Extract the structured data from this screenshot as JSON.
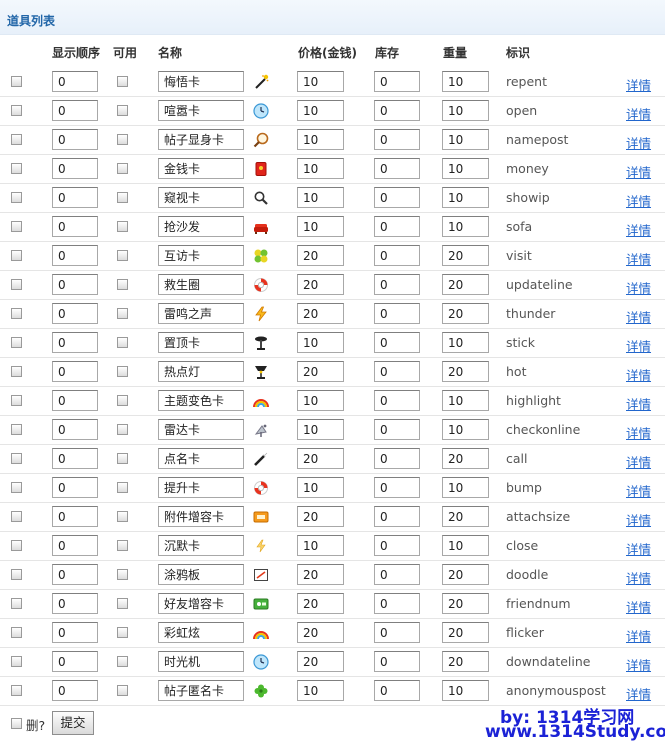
{
  "section_title": "道具列表",
  "headers": {
    "order": "显示顺序",
    "enabled": "可用",
    "name": "名称",
    "price": "价格(金钱)",
    "stock": "库存",
    "weight": "重量",
    "ident": "标识"
  },
  "items": [
    {
      "order": "0",
      "name": "悔悟卡",
      "icon": "magic-wand-icon",
      "price": "10",
      "stock": "0",
      "weight": "10",
      "ident": "repent",
      "detail": "详情"
    },
    {
      "order": "0",
      "name": "喧嚣卡",
      "icon": "clock-icon",
      "price": "10",
      "stock": "0",
      "weight": "10",
      "ident": "open",
      "detail": "详情"
    },
    {
      "order": "0",
      "name": "帖子显身卡",
      "icon": "magnifier-icon",
      "price": "10",
      "stock": "0",
      "weight": "10",
      "ident": "namepost",
      "detail": "详情"
    },
    {
      "order": "0",
      "name": "金钱卡",
      "icon": "red-envelope-icon",
      "price": "10",
      "stock": "0",
      "weight": "10",
      "ident": "money",
      "detail": "详情"
    },
    {
      "order": "0",
      "name": "窥视卡",
      "icon": "magnifier-small-icon",
      "price": "10",
      "stock": "0",
      "weight": "10",
      "ident": "showip",
      "detail": "详情"
    },
    {
      "order": "0",
      "name": "抢沙发",
      "icon": "sofa-icon",
      "price": "10",
      "stock": "0",
      "weight": "10",
      "ident": "sofa",
      "detail": "详情"
    },
    {
      "order": "0",
      "name": "互访卡",
      "icon": "visit-icon",
      "price": "20",
      "stock": "0",
      "weight": "20",
      "ident": "visit",
      "detail": "详情"
    },
    {
      "order": "0",
      "name": "救生圈",
      "icon": "life-ring-icon",
      "price": "20",
      "stock": "0",
      "weight": "20",
      "ident": "updateline",
      "detail": "详情"
    },
    {
      "order": "0",
      "name": "雷鸣之声",
      "icon": "lightning-icon",
      "price": "20",
      "stock": "0",
      "weight": "20",
      "ident": "thunder",
      "detail": "详情"
    },
    {
      "order": "0",
      "name": "置顶卡",
      "icon": "pin-icon",
      "price": "10",
      "stock": "0",
      "weight": "10",
      "ident": "stick",
      "detail": "详情"
    },
    {
      "order": "0",
      "name": "热点灯",
      "icon": "lamp-icon",
      "price": "20",
      "stock": "0",
      "weight": "20",
      "ident": "hot",
      "detail": "详情"
    },
    {
      "order": "0",
      "name": "主题变色卡",
      "icon": "rainbow-icon",
      "price": "10",
      "stock": "0",
      "weight": "10",
      "ident": "highlight",
      "detail": "详情"
    },
    {
      "order": "0",
      "name": "雷达卡",
      "icon": "radar-icon",
      "price": "10",
      "stock": "0",
      "weight": "10",
      "ident": "checkonline",
      "detail": "详情"
    },
    {
      "order": "0",
      "name": "点名卡",
      "icon": "wand-icon",
      "price": "20",
      "stock": "0",
      "weight": "20",
      "ident": "call",
      "detail": "详情"
    },
    {
      "order": "0",
      "name": "提升卡",
      "icon": "life-ring-icon",
      "price": "10",
      "stock": "0",
      "weight": "10",
      "ident": "bump",
      "detail": "详情"
    },
    {
      "order": "0",
      "name": "附件增容卡",
      "icon": "attachment-card-icon",
      "price": "20",
      "stock": "0",
      "weight": "20",
      "ident": "attachsize",
      "detail": "详情"
    },
    {
      "order": "0",
      "name": "沉默卡",
      "icon": "lightning-small-icon",
      "price": "10",
      "stock": "0",
      "weight": "10",
      "ident": "close",
      "detail": "详情"
    },
    {
      "order": "0",
      "name": "涂鸦板",
      "icon": "doodle-board-icon",
      "price": "20",
      "stock": "0",
      "weight": "20",
      "ident": "doodle",
      "detail": "详情"
    },
    {
      "order": "0",
      "name": "好友增容卡",
      "icon": "friend-card-icon",
      "price": "20",
      "stock": "0",
      "weight": "20",
      "ident": "friendnum",
      "detail": "详情"
    },
    {
      "order": "0",
      "name": "彩虹炫",
      "icon": "rainbow-icon",
      "price": "20",
      "stock": "0",
      "weight": "20",
      "ident": "flicker",
      "detail": "详情"
    },
    {
      "order": "0",
      "name": "时光机",
      "icon": "clock-icon",
      "price": "20",
      "stock": "0",
      "weight": "20",
      "ident": "downdateline",
      "detail": "详情"
    },
    {
      "order": "0",
      "name": "帖子匿名卡",
      "icon": "clover-icon",
      "price": "10",
      "stock": "0",
      "weight": "10",
      "ident": "anonymouspost",
      "detail": "详情"
    }
  ],
  "footer": {
    "delete_label": "删?",
    "submit_label": "提交"
  },
  "watermark": {
    "line1": "by: 1314学习网",
    "line2": "www.1314Study.com"
  },
  "colors": {
    "title": "#2266a8",
    "link": "#2266cc",
    "watermark": "#1b22d6"
  }
}
